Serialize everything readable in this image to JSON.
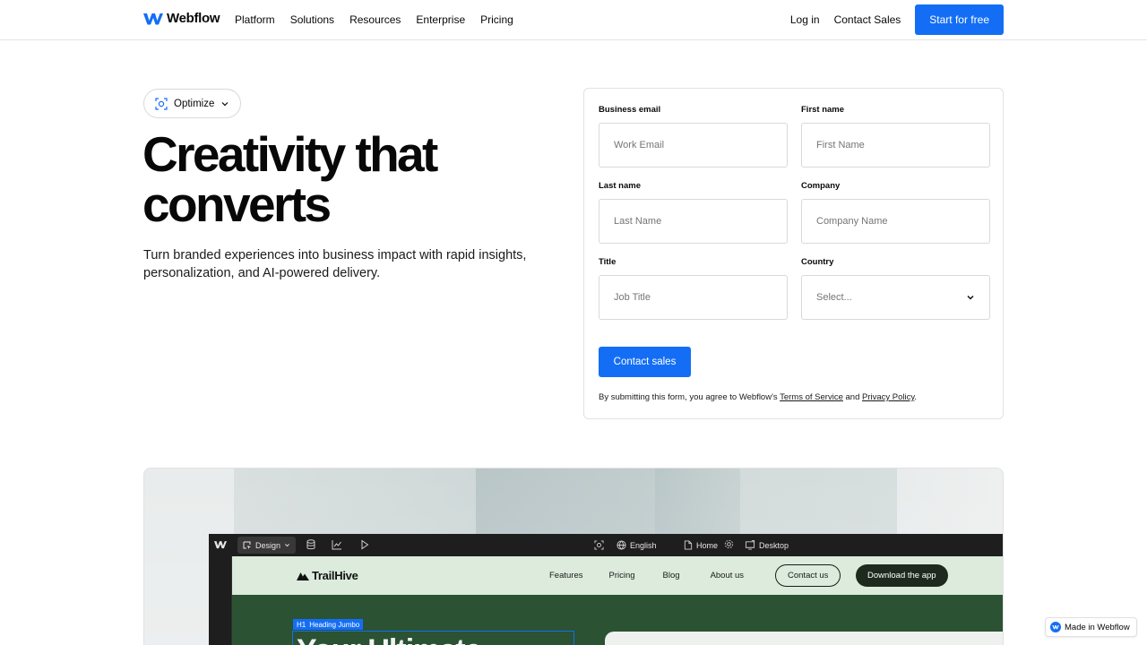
{
  "nav": {
    "brand": "Webflow",
    "links": [
      "Platform",
      "Solutions",
      "Resources",
      "Enterprise",
      "Pricing"
    ],
    "login": "Log in",
    "contact_sales": "Contact Sales",
    "cta": "Start for free"
  },
  "hero": {
    "pill_label": "Optimize",
    "title_line1": "Creativity that",
    "title_line2": "converts",
    "subtitle": "Turn branded experiences into business impact with rapid insights, personalization, and AI-powered delivery."
  },
  "form": {
    "fields": [
      {
        "label": "Business email",
        "placeholder": "Work Email"
      },
      {
        "label": "First name",
        "placeholder": "First Name"
      },
      {
        "label": "Last name",
        "placeholder": "Last Name"
      },
      {
        "label": "Company",
        "placeholder": "Company Name"
      },
      {
        "label": "Title",
        "placeholder": "Job Title"
      },
      {
        "label": "Country",
        "placeholder": "Select..."
      }
    ],
    "submit": "Contact sales",
    "legal_prefix": "By submitting this form, you agree to Webflow's ",
    "terms": "Terms of Service",
    "legal_mid": " and ",
    "privacy": "Privacy Policy",
    "legal_suffix": "."
  },
  "editor": {
    "mode": "Design",
    "locale": "English",
    "page": "Home",
    "breakpoint": "Desktop"
  },
  "site_preview": {
    "brand": "TrailHive",
    "links": [
      "Features",
      "Pricing",
      "Blog",
      "About us"
    ],
    "contact": "Contact us",
    "download": "Download the app",
    "element_tag": "H1",
    "element_name": "Heading Jumbo",
    "heading_partial": "Your Ultimate"
  },
  "badge": {
    "label": "Made in Webflow"
  },
  "colors": {
    "accent": "#146ef5",
    "site_nav": "#dcebdc",
    "site_hero": "#2a5233",
    "editor_bg": "#1e1e1e"
  }
}
